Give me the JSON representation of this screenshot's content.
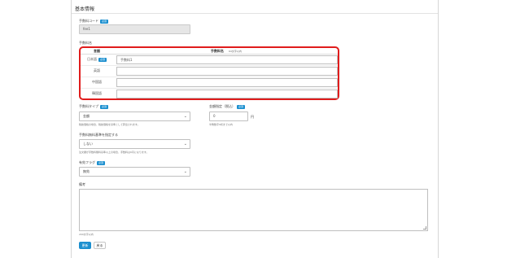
{
  "section": {
    "title": "基本情報"
  },
  "fee_code": {
    "label": "手数料コード",
    "required": "必須",
    "value": "fee1"
  },
  "fee_name": {
    "label": "手数料名",
    "header_lang": "言語",
    "header_name": "手数料名",
    "header_note": "64文字以内",
    "required": "必須",
    "rows": [
      {
        "lang": "日本語",
        "value": "手数料1"
      },
      {
        "lang": "英語",
        "value": ""
      },
      {
        "lang": "中国語",
        "value": ""
      },
      {
        "lang": "韓国語",
        "value": ""
      }
    ]
  },
  "fee_type": {
    "label": "手数料タイプ",
    "required": "必須",
    "value": "金額",
    "hint": "税抜価格の場合、税抜価格を基準として算出されます。"
  },
  "amount": {
    "label": "金額指定（税込）",
    "required": "必須",
    "value": "0",
    "unit": "円",
    "hint": "半角数字9桁まで以内"
  },
  "priority": {
    "label": "手数料無料基準を指定する",
    "value": "しない",
    "hint": "注文額が手数料無料基準以上の場合、手数料は0円になります。"
  },
  "valid_flag": {
    "label": "有効フラグ",
    "required": "必須",
    "value": "無効"
  },
  "remarks": {
    "label": "備考",
    "hint": "200文字以内"
  },
  "buttons": {
    "submit": "更新",
    "back": "戻る"
  }
}
